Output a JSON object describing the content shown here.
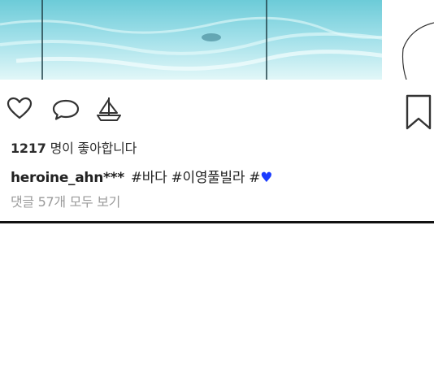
{
  "post": {
    "likes_count": "1217",
    "likes_suffix": "명이 좋아합니다",
    "username": "heroine_ahn***",
    "caption_text": "#바다 #이영풀빌라 #",
    "caption_emoji": "♥",
    "view_comments": "댓글 57개 모두 보기"
  },
  "icons": {
    "like": "heart-outline-icon",
    "comment": "speech-bubble-icon",
    "share": "sailboat-icon",
    "bookmark": "bookmark-icon"
  },
  "colors": {
    "heart_emoji": "#1a3cff",
    "muted_text": "#9a9a9a",
    "water": "#a6e3ea"
  }
}
